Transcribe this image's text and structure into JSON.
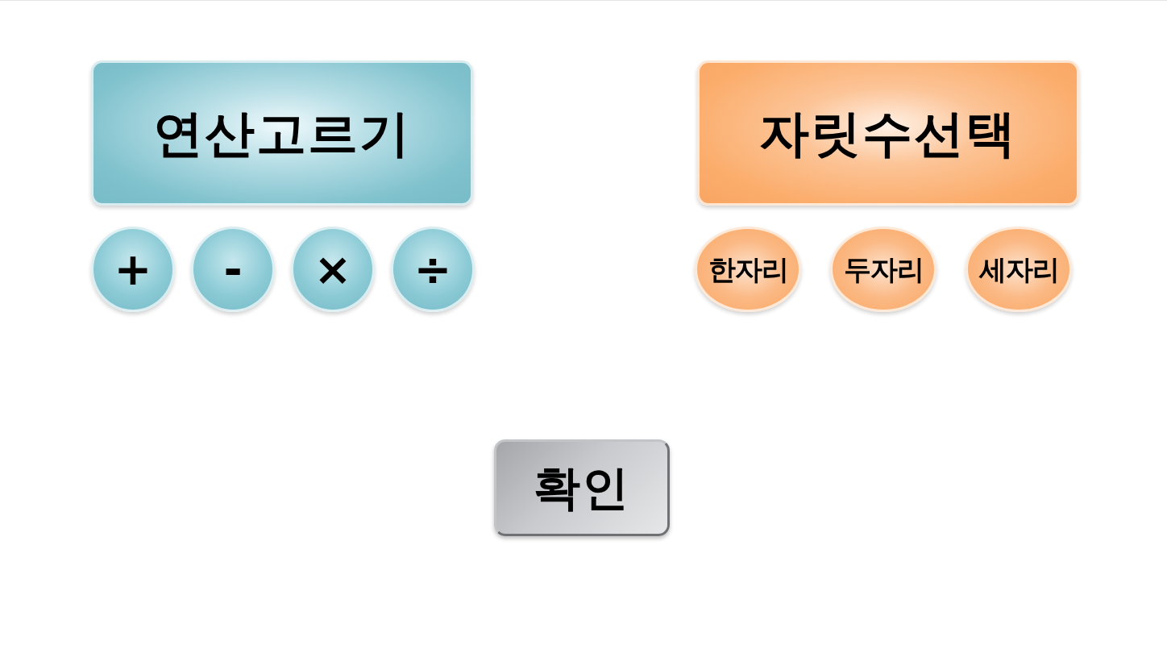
{
  "panels": [
    {
      "kind": "operation",
      "title": "연산고르기",
      "options": [
        {
          "label": "+"
        },
        {
          "label": "-"
        },
        {
          "label": "×"
        },
        {
          "label": "÷"
        }
      ]
    },
    {
      "kind": "digits",
      "title": "자릿수선택",
      "options": [
        {
          "label": "한자리"
        },
        {
          "label": "두자리"
        },
        {
          "label": "세자리"
        }
      ]
    }
  ],
  "confirm_button": {
    "label": "확인"
  }
}
